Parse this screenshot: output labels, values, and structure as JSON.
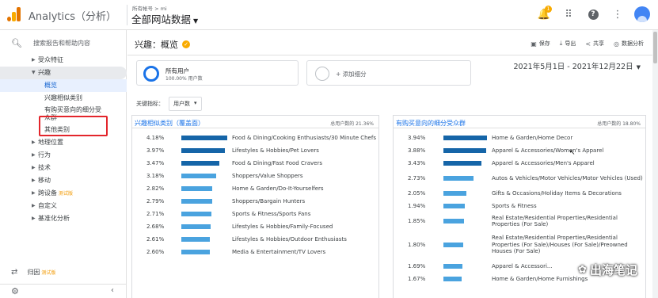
{
  "app": {
    "title": "Analytics（分析）",
    "breadcrumb": "所有帐号 > mi",
    "property": "全部网站数据"
  },
  "header_icons": {
    "bell_badge": "1",
    "icons": [
      "bell-icon",
      "apps-grid-icon",
      "help-icon",
      "more-vert-icon",
      "account-icon"
    ]
  },
  "sidebar": {
    "search_placeholder": "搜索报告和帮助内容",
    "items": [
      {
        "label": "受众特征",
        "level": 1,
        "expanded": false
      },
      {
        "label": "兴趣",
        "level": 1,
        "expanded": true
      },
      {
        "label": "概览",
        "level": 2,
        "active": true
      },
      {
        "label": "兴趣相似类别",
        "level": 2
      },
      {
        "label": "有购买意向的细分受众群",
        "level": 2,
        "highlighted": true
      },
      {
        "label": "其他类别",
        "level": 2
      },
      {
        "label": "地理位置",
        "level": 1
      },
      {
        "label": "行为",
        "level": 1
      },
      {
        "label": "技术",
        "level": 1
      },
      {
        "label": "移动",
        "level": 1
      },
      {
        "label": "跨设备",
        "level": 1,
        "badge": "测试版"
      },
      {
        "label": "自定义",
        "level": 1
      },
      {
        "label": "基准化分析",
        "level": 1
      }
    ],
    "attribution": {
      "label": "归因",
      "badge": "测试版"
    }
  },
  "page": {
    "title": "兴趣：概览",
    "actions": [
      {
        "label": "保存",
        "icon": "save-icon"
      },
      {
        "label": "导出",
        "icon": "export-icon"
      },
      {
        "label": "共享",
        "icon": "share-icon"
      },
      {
        "label": "数据分析",
        "icon": "insights-icon"
      }
    ],
    "segment": {
      "name": "所有用户",
      "sub": "100.00% 用户数"
    },
    "add_segment": "+ 添加细分",
    "date_range": "2021年5月1日 - 2021年12月22日",
    "key_metric_label": "关键指标：",
    "key_metric_value": "用户数"
  },
  "panels": {
    "affinity": {
      "title": "兴趣相似类别（覆盖面）",
      "total": "总用户数的 21.36%",
      "rows": [
        {
          "pct": "4.18%",
          "value": 4.18,
          "label": "Food & Dining/Cooking Enthusiasts/30 Minute Chefs"
        },
        {
          "pct": "3.97%",
          "value": 3.97,
          "label": "Lifestyles & Hobbies/Pet Lovers"
        },
        {
          "pct": "3.47%",
          "value": 3.47,
          "label": "Food & Dining/Fast Food Cravers"
        },
        {
          "pct": "3.18%",
          "value": 3.18,
          "label": "Shoppers/Value Shoppers"
        },
        {
          "pct": "2.82%",
          "value": 2.82,
          "label": "Home & Garden/Do-It-Yourselfers"
        },
        {
          "pct": "2.79%",
          "value": 2.79,
          "label": "Shoppers/Bargain Hunters"
        },
        {
          "pct": "2.71%",
          "value": 2.71,
          "label": "Sports & Fitness/Sports Fans"
        },
        {
          "pct": "2.68%",
          "value": 2.68,
          "label": "Lifestyles & Hobbies/Family-Focused"
        },
        {
          "pct": "2.61%",
          "value": 2.61,
          "label": "Lifestyles & Hobbies/Outdoor Enthusiasts"
        },
        {
          "pct": "2.60%",
          "value": 2.6,
          "label": "Media & Entertainment/TV Lovers"
        }
      ]
    },
    "inmarket": {
      "title": "有购买意向的细分受众群",
      "total": "总用户数的 18.80%",
      "rows": [
        {
          "pct": "3.94%",
          "value": 3.94,
          "label": "Home & Garden/Home Decor",
          "h": 1
        },
        {
          "pct": "3.88%",
          "value": 3.88,
          "label": "Apparel & Accessories/Women's Apparel",
          "h": 1
        },
        {
          "pct": "3.43%",
          "value": 3.43,
          "label": "Apparel & Accessories/Men's Apparel",
          "h": 1
        },
        {
          "pct": "2.73%",
          "value": 2.73,
          "label": "Autos & Vehicles/Motor Vehicles/Motor Vehicles (Used)",
          "h": 2
        },
        {
          "pct": "2.05%",
          "value": 2.05,
          "label": "Gifts & Occasions/Holiday Items & Decorations",
          "h": 1
        },
        {
          "pct": "1.94%",
          "value": 1.94,
          "label": "Sports & Fitness",
          "h": 1
        },
        {
          "pct": "1.85%",
          "value": 1.85,
          "label": "Real Estate/Residential Properties/Residential Properties (For Sale)",
          "h": 2
        },
        {
          "pct": "1.80%",
          "value": 1.8,
          "label": "Real Estate/Residential Properties/Residential Properties (For Sale)/Houses (For Sale)/Preowned Houses (For Sale)",
          "h": 3
        },
        {
          "pct": "1.69%",
          "value": 1.69,
          "label": "Apparel & Accessori...",
          "h": 1
        },
        {
          "pct": "1.67%",
          "value": 1.67,
          "label": "Home & Garden/Home Furnishings",
          "h": 1
        }
      ]
    }
  },
  "watermark": "出海笔记",
  "colors": {
    "bar_dark": "#1565a8",
    "bar_light": "#4aa3df",
    "accent": "#1a73e8",
    "highlight": "#e3262c"
  }
}
